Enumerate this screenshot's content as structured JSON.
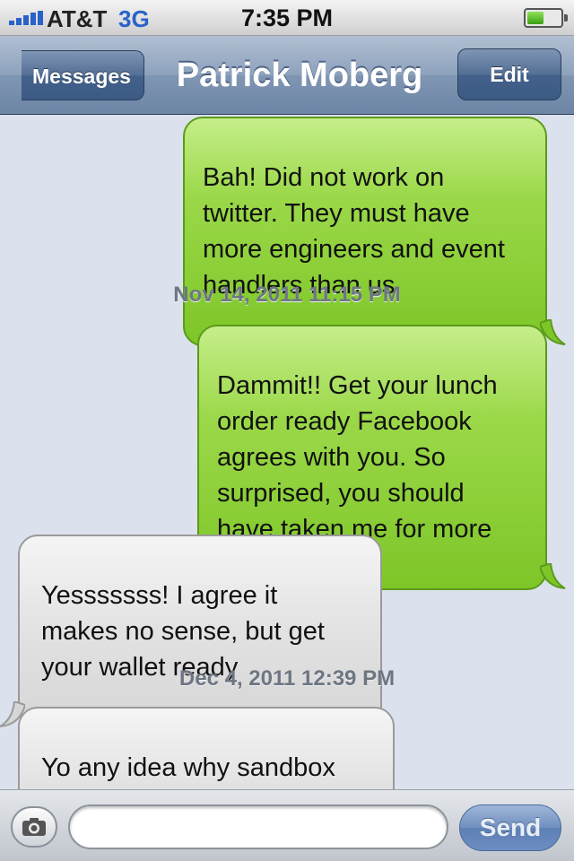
{
  "status_bar": {
    "carrier": "AT&T",
    "network": "3G",
    "time": "7:35 PM",
    "signal_bars": 5,
    "battery_level": 0.5
  },
  "nav_bar": {
    "back_label": "Messages",
    "title": "Patrick Moberg",
    "edit_label": "Edit"
  },
  "messages": [
    {
      "direction": "sent",
      "text": "Bah! Did not work on\ntwitter. They must have\nmore engineers and event\nhandlers than us"
    },
    {
      "timestamp": "Nov 14, 2011 11:15 PM"
    },
    {
      "direction": "sent",
      "text": "Dammit!! Get your lunch\norder ready Facebook\nagrees with you.  So\nsurprised, you should\nhave taken me for more"
    },
    {
      "direction": "received",
      "text": "Yesssssss! I agree it\nmakes no sense, but get\nyour wallet ready"
    },
    {
      "timestamp": "Dec 4, 2011 12:39 PM"
    },
    {
      "direction": "received",
      "text": "Yo any idea why sandbox\nis down?"
    }
  ],
  "input_bar": {
    "placeholder": "",
    "send_label": "Send"
  },
  "colors": {
    "sent_bubble": "#8fd03a",
    "received_bubble": "#e2e2e2",
    "nav_bar": "#8ea2bd",
    "background": "#dbe2ed",
    "accent_blue": "#2a62c9"
  },
  "icons": {
    "camera": "camera-icon",
    "back": "back-arrow",
    "battery": "battery-icon",
    "signal": "signal-icon"
  }
}
